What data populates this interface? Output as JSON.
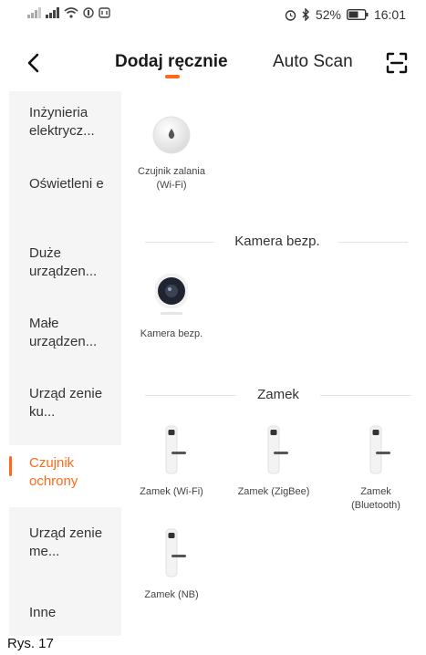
{
  "status_bar": {
    "signal_icons": "…",
    "battery": "52%",
    "time": "16:01"
  },
  "header": {
    "tab_manual": "Dodaj ręcznie",
    "tab_auto": "Auto Scan",
    "accent_color": "#ff6a1a"
  },
  "sidebar": {
    "items": [
      {
        "label": "Inżynieria elektrycz..."
      },
      {
        "label": "Oświetleni e"
      },
      {
        "label": "Duże urządzen..."
      },
      {
        "label": "Małe urządzen..."
      },
      {
        "label": "Urząd zenie ku..."
      },
      {
        "label": "Czujnik ochrony",
        "active": true
      },
      {
        "label": "Urząd zenie me..."
      },
      {
        "label": "Inne"
      }
    ]
  },
  "content": {
    "top_devices": [
      {
        "name": "Czujnik zalania (Wi-Fi)",
        "icon": "water-sensor-icon"
      }
    ],
    "sections": [
      {
        "title": "Kamera bezp.",
        "devices": [
          {
            "name": "Kamera bezp.",
            "icon": "camera-icon"
          }
        ]
      },
      {
        "title": "Zamek",
        "devices": [
          {
            "name": "Zamek (Wi-Fi)",
            "icon": "lock-icon"
          },
          {
            "name": "Zamek (ZigBee)",
            "icon": "lock-icon"
          },
          {
            "name": "Zamek (Bluetooth)",
            "icon": "lock-icon"
          },
          {
            "name": "Zamek (NB)",
            "icon": "lock-icon"
          }
        ]
      }
    ]
  },
  "caption": "Rys. 17"
}
